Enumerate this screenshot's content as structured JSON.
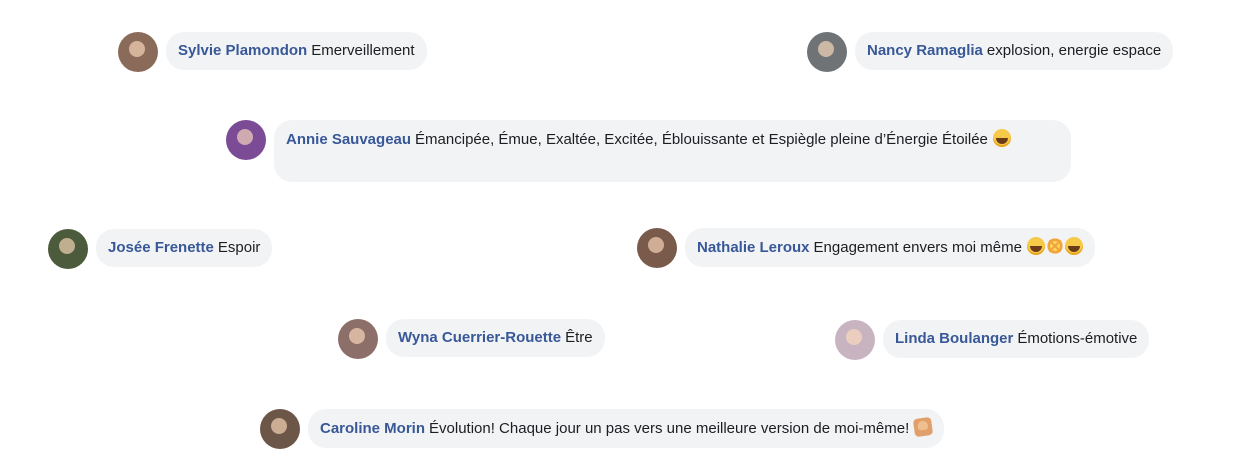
{
  "comments": [
    {
      "author": "Sylvie Plamondon",
      "text": "Emerveillement",
      "avatar_color": "#8a6b5a"
    },
    {
      "author": "Nancy Ramaglia",
      "text": "explosion, energie espace",
      "avatar_color": "#6f7376"
    },
    {
      "author": "Annie Sauvageau",
      "text": "Émancipée, Émue, Exaltée, Excitée, Éblouissante et Espiègle pleine d’Énergie Étoilée",
      "emoji": [
        "grinning-squinting-face-emoji"
      ],
      "avatar_color": "#7b4c95"
    },
    {
      "author": "Josée Frenette",
      "text": "Espoir",
      "avatar_color": "#4b5b3b"
    },
    {
      "author": "Nathalie Leroux",
      "text": "Engagement envers moi même",
      "emoji": [
        "grinning-squinting-face-emoji",
        "collision-emoji",
        "grinning-squinting-face-emoji"
      ],
      "avatar_color": "#7a5a4a"
    },
    {
      "author": "Wyna Cuerrier-Rouette",
      "text": "Être",
      "avatar_color": "#8d6f6a"
    },
    {
      "author": "Linda Boulanger",
      "text": "Émotions-émotive",
      "avatar_color": "#c8b4c0"
    },
    {
      "author": "Caroline Morin",
      "text": "Évolution! Chaque jour un pas vers une meilleure version de moi-même!",
      "emoji": [
        "flexed-biceps-emoji"
      ],
      "avatar_color": "#6c5647"
    }
  ],
  "colors": {
    "bubble_background": "#f2f3f5",
    "name_text": "#385898",
    "body_text": "#1c1e21"
  }
}
